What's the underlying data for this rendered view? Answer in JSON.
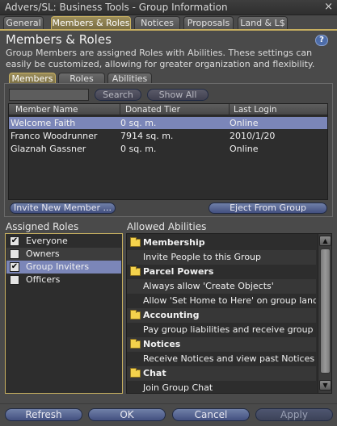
{
  "window": {
    "title": "Advers/SL: Business Tools - Group Information",
    "close_glyph": "×"
  },
  "tabs": [
    {
      "label": "General"
    },
    {
      "label": "Members & Roles"
    },
    {
      "label": "Notices"
    },
    {
      "label": "Proposals"
    },
    {
      "label": "Land & L$"
    }
  ],
  "header": {
    "title": "Members & Roles",
    "help_glyph": "?",
    "description": "Group Members are assigned Roles with Abilities. These settings can easily be customized, allowing for greater organization and flexibility."
  },
  "subtabs": [
    {
      "label": "Members"
    },
    {
      "label": "Roles"
    },
    {
      "label": "Abilities"
    }
  ],
  "members": {
    "search_value": "",
    "search_button": "Search",
    "show_all_button": "Show All",
    "columns": [
      "Member Name",
      "Donated Tier",
      "Last Login"
    ],
    "rows": [
      {
        "name": "Welcome Faith",
        "tier": "0 sq. m.",
        "login": "Online"
      },
      {
        "name": "Franco Woodrunner",
        "tier": "7914 sq. m.",
        "login": "2010/1/20"
      },
      {
        "name": "Glaznah Gassner",
        "tier": "0 sq. m.",
        "login": "Online"
      }
    ],
    "invite_button": "Invite New Member ...",
    "eject_button": "Eject From Group"
  },
  "assigned_roles": {
    "label": "Assigned Roles",
    "items": [
      {
        "label": "Everyone",
        "checked": "✔"
      },
      {
        "label": "Owners",
        "checked": ""
      },
      {
        "label": "Group Inviters",
        "checked": "✔"
      },
      {
        "label": "Officers",
        "checked": ""
      }
    ]
  },
  "allowed_abilities": {
    "label": "Allowed Abilities",
    "scroll_up_glyph": "▲",
    "scroll_down_glyph": "▼",
    "items": [
      {
        "label": "Membership",
        "group": true
      },
      {
        "label": "Invite People to this Group",
        "group": false
      },
      {
        "label": "Parcel Powers",
        "group": true
      },
      {
        "label": "Always allow 'Create Objects'",
        "group": false
      },
      {
        "label": "Allow 'Set Home to Here' on group land",
        "group": false
      },
      {
        "label": "Accounting",
        "group": true
      },
      {
        "label": "Pay group liabilities and receive group di...",
        "group": false
      },
      {
        "label": "Notices",
        "group": true
      },
      {
        "label": "Receive Notices and view past Notices",
        "group": false
      },
      {
        "label": "Chat",
        "group": true
      },
      {
        "label": "Join Group Chat",
        "group": false
      }
    ]
  },
  "footer": {
    "refresh": "Refresh",
    "ok": "OK",
    "cancel": "Cancel",
    "apply": "Apply"
  }
}
